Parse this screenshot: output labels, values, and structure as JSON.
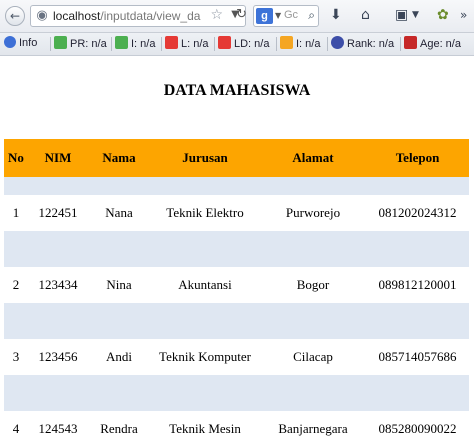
{
  "browser": {
    "url_host": "localhost",
    "url_path": "/inputdata/view_da",
    "search_placeholder": "Gc",
    "search_engine_letter": "g",
    "toolbar": [
      {
        "label": "Info",
        "color": "#3d6fd6",
        "icon": "info-icon"
      },
      {
        "label": "PR: n/a",
        "color": "#4caf50",
        "icon": "google-pr-icon"
      },
      {
        "label": "I: n/a",
        "color": "#4caf50",
        "icon": "google-index-icon"
      },
      {
        "label": "L: n/a",
        "color": "#e53935",
        "icon": "links-icon"
      },
      {
        "label": "LD: n/a",
        "color": "#e53935",
        "icon": "link-domains-icon"
      },
      {
        "label": "I: n/a",
        "color": "#f5a623",
        "icon": "bing-index-icon"
      },
      {
        "label": "Rank: n/a",
        "color": "#3d4ea8",
        "icon": "alexa-rank-icon"
      },
      {
        "label": "Age: n/a",
        "color": "#c62828",
        "icon": "domain-age-icon"
      }
    ]
  },
  "page": {
    "title": "DATA MAHASISWA"
  },
  "table": {
    "headers": [
      "No",
      "NIM",
      "Nama",
      "Jurusan",
      "Alamat",
      "Telepon"
    ],
    "rows": [
      [
        "1",
        "122451",
        "Nana",
        "Teknik Elektro",
        "Purworejo",
        "081202024312"
      ],
      [
        "2",
        "123434",
        "Nina",
        "Akuntansi",
        "Bogor",
        "089812120001"
      ],
      [
        "3",
        "123456",
        "Andi",
        "Teknik Komputer",
        "Cilacap",
        "085714057686"
      ],
      [
        "4",
        "124543",
        "Rendra",
        "Teknik Mesin",
        "Banjarnegara",
        "085280090022"
      ]
    ]
  },
  "colors": {
    "header_bg": "#fda500",
    "stripe_bg": "#dfe7f2"
  }
}
